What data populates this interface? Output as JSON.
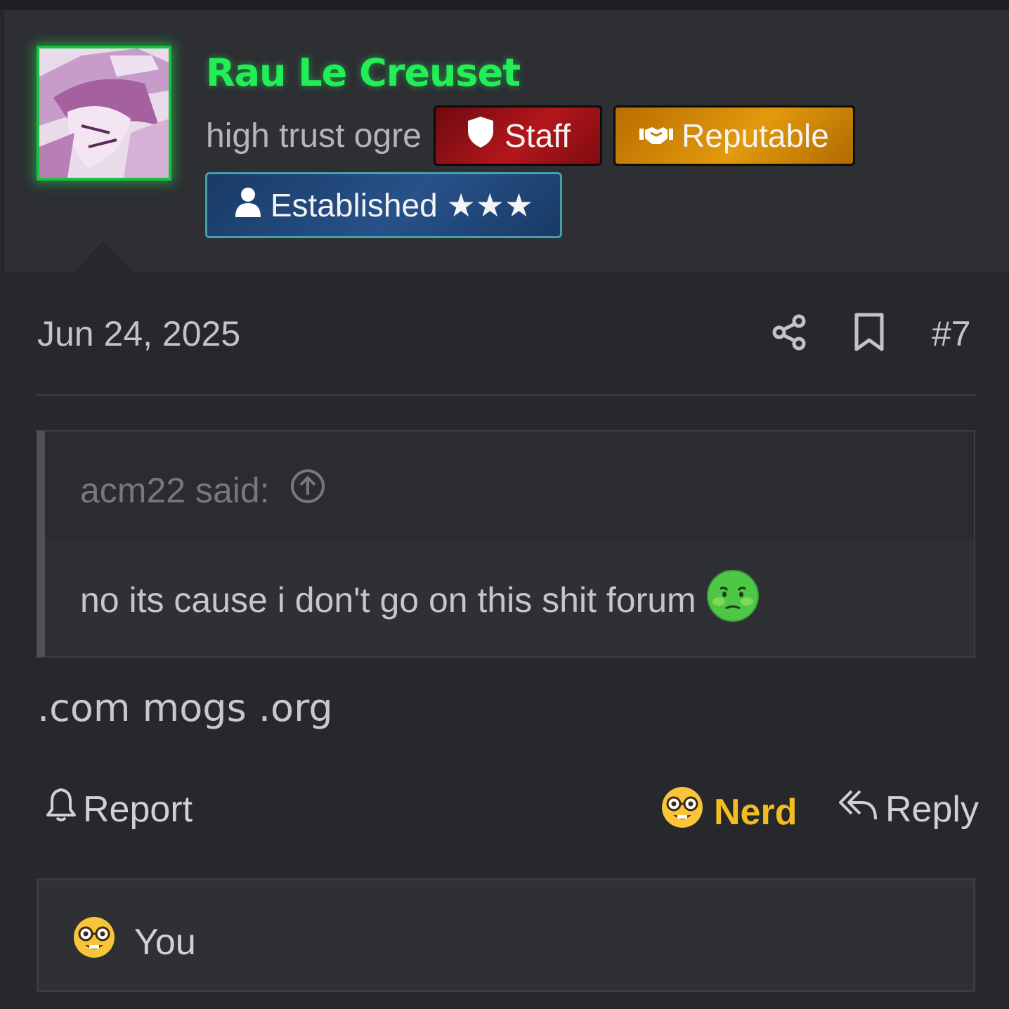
{
  "user": {
    "name": "Rau Le Creuset",
    "title": "high trust ogre",
    "name_color": "#22ee55"
  },
  "badges": {
    "staff": {
      "label": "Staff",
      "icon": "shield-icon",
      "color": "#b3161c"
    },
    "reputable": {
      "label": "Reputable",
      "icon": "handshake-icon",
      "color": "#e39a0c"
    },
    "established": {
      "label": "Established ★★★",
      "icon": "user-icon",
      "color": "#275289"
    }
  },
  "post": {
    "date": "Jun 24, 2025",
    "number": "#7",
    "text": ".com mogs .org"
  },
  "quote": {
    "author": "acm22 said:",
    "text": "no its cause i don't go on this shit forum",
    "emoji": "nauseated-face-icon"
  },
  "actions": {
    "report": "Report",
    "reaction": "Nerd",
    "reaction_color": "#f3bd1f",
    "reply": "Reply"
  },
  "reactions": {
    "user": "You",
    "emoji": "nerd-face-icon"
  }
}
